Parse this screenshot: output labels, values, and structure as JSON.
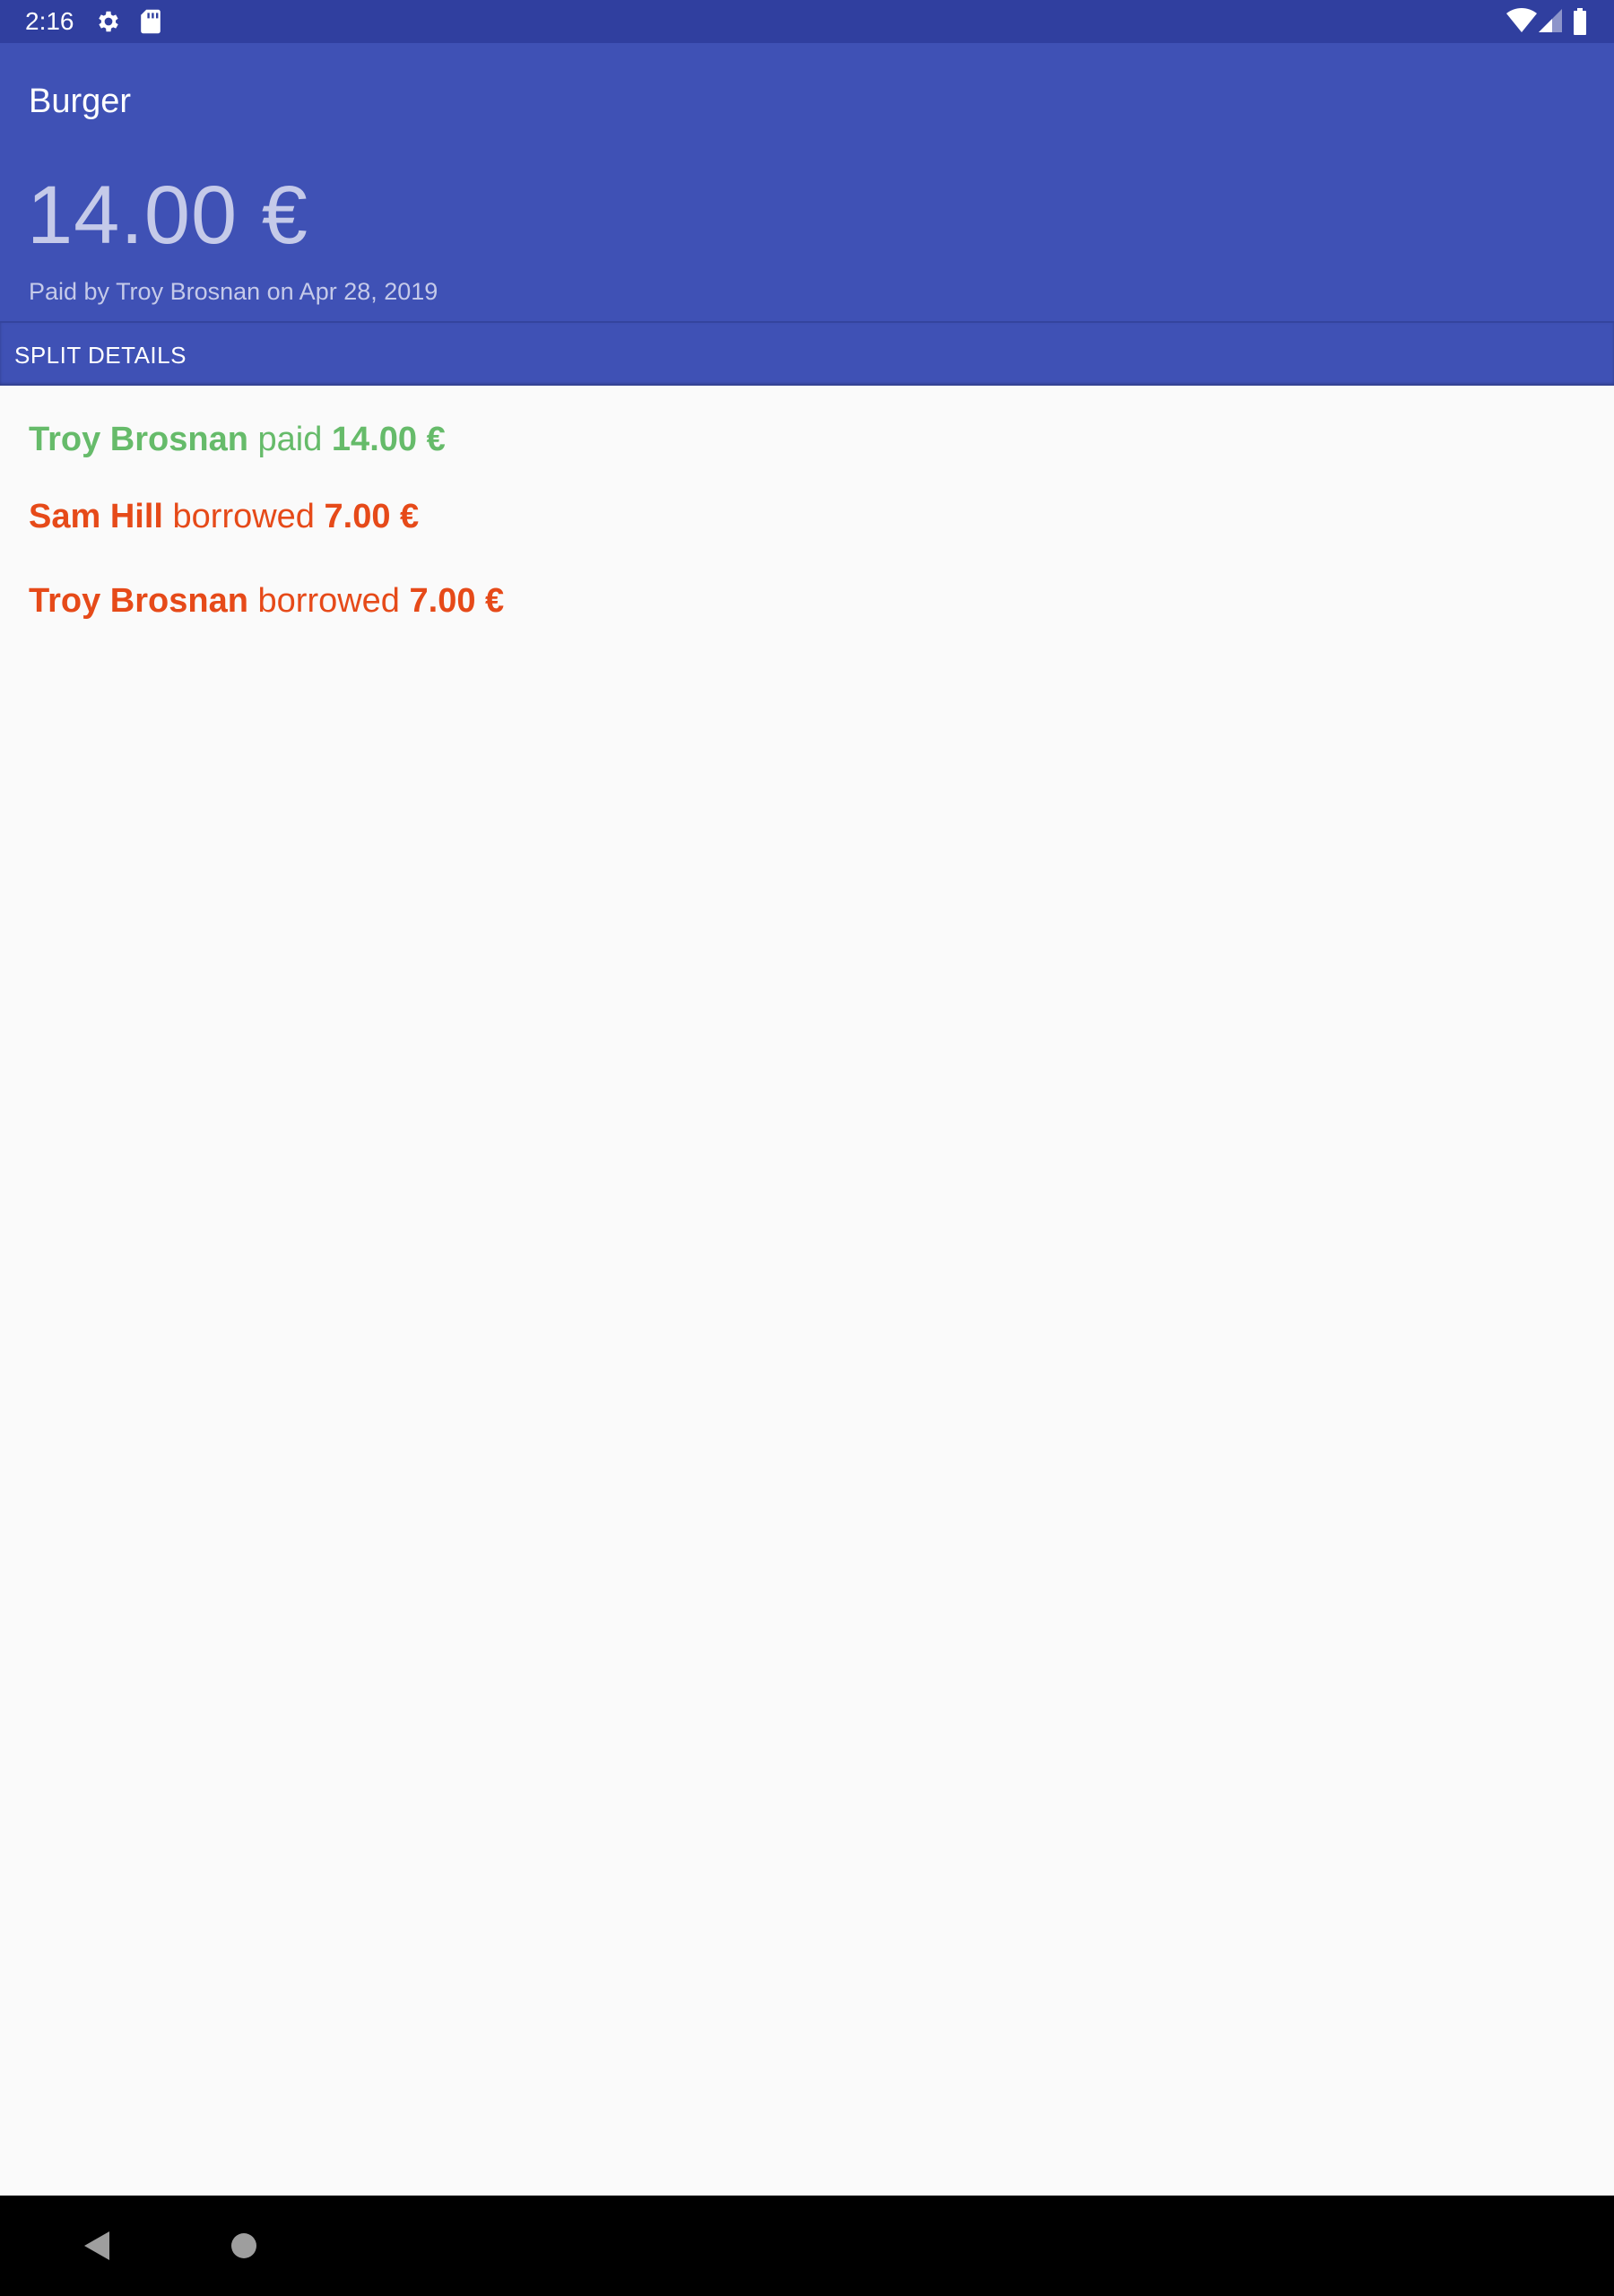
{
  "status_bar": {
    "time": "2:16",
    "left_icons": [
      "gear-icon",
      "sd-card-icon"
    ],
    "right_icons": [
      "wifi-icon",
      "cell-signal-icon",
      "battery-icon"
    ]
  },
  "header": {
    "title": "Burger",
    "amount": "14.00 €",
    "paid_by_text": "Paid by Troy Brosnan on Apr 28, 2019"
  },
  "section": {
    "title": "SPLIT DETAILS"
  },
  "splits": [
    {
      "name": "Troy Brosnan",
      "action": "paid",
      "amount": "14.00 €",
      "status": "paid"
    },
    {
      "name": "Sam Hill",
      "action": "borrowed",
      "amount": "7.00 €",
      "status": "borrowed"
    },
    {
      "name": "Troy Brosnan",
      "action": "borrowed",
      "amount": "7.00 €",
      "status": "borrowed"
    }
  ],
  "colors": {
    "primary": "#3f51b5",
    "primary_dark": "#303f9f",
    "paid": "#66bb6a",
    "borrowed": "#e64a19"
  },
  "nav_bar": {
    "buttons": [
      "back-icon",
      "home-icon"
    ]
  }
}
